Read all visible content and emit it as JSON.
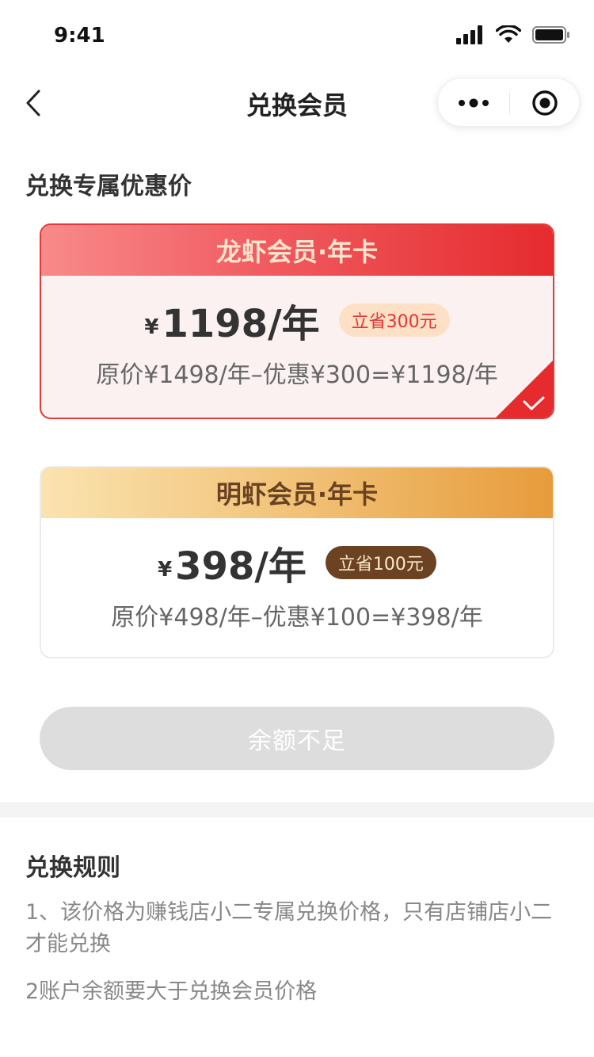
{
  "status_bar": {
    "time": "9:41",
    "icons": [
      "signal-icon",
      "wifi-icon",
      "battery-icon"
    ]
  },
  "nav": {
    "title": "兑换会员",
    "back_icon": "chevron-left-icon",
    "menu_icon": "more-dots-icon",
    "close_icon": "target-close-icon"
  },
  "section_heading": "兑换专属优惠价",
  "cards": [
    {
      "name": "龙虾会员·年卡",
      "currency": "¥",
      "price": "1198/年",
      "save_badge": "立省300元",
      "formula": "原价¥1498/年–优惠¥300=¥1198/年",
      "selected": true,
      "accent": "#e52b2e"
    },
    {
      "name": "明虾会员·年卡",
      "currency": "¥",
      "price": "398/年",
      "save_badge": "立省100元",
      "formula": "原价¥498/年–优惠¥100=¥398/年",
      "selected": false,
      "accent": "#e79b3b"
    }
  ],
  "action_button": {
    "label": "余额不足",
    "enabled": false
  },
  "rules": {
    "title": "兑换规则",
    "items": [
      "1、该价格为赚钱店小二专属兑换价格，只有店铺店小二才能兑换",
      "2账户余额要大于兑换会员价格"
    ]
  }
}
